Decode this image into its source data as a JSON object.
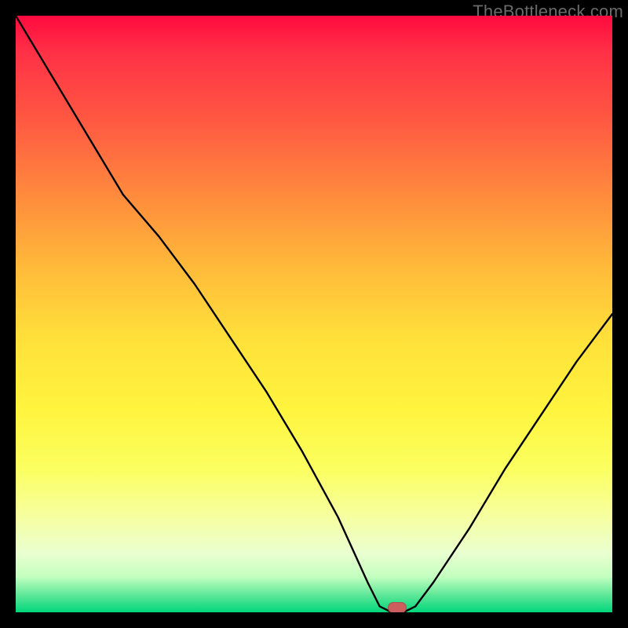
{
  "watermark": "TheBottleneck.com",
  "marker": {
    "x_pct": 64,
    "y_pct": 99.2,
    "color": "#cc5e5e"
  },
  "chart_data": {
    "type": "line",
    "title": "",
    "xlabel": "",
    "ylabel": "",
    "xlim": [
      0,
      100
    ],
    "ylim": [
      0,
      100
    ],
    "grid": false,
    "legend": false,
    "note": "Unlabeled bottleneck curve; percentages along y inferred from vertical position (0 at bottom-green, 100 at top-red). x inferred left→right 0–100.",
    "series": [
      {
        "name": "bottleneck-curve",
        "x": [
          0,
          6,
          12,
          18,
          24,
          30,
          36,
          42,
          48,
          54,
          59,
          61,
          63,
          65,
          67,
          70,
          76,
          82,
          88,
          94,
          100
        ],
        "y": [
          100,
          90,
          80,
          70,
          63,
          55,
          46,
          37,
          27,
          16,
          5,
          1,
          0,
          0,
          1,
          5,
          14,
          24,
          33,
          42,
          50
        ]
      }
    ],
    "marker_point": {
      "x": 64,
      "y": 0.8
    },
    "background_gradient": {
      "orientation": "vertical",
      "stops": [
        {
          "pct": 0,
          "color": "#ff0a3f"
        },
        {
          "pct": 18,
          "color": "#ff5a42"
        },
        {
          "pct": 42,
          "color": "#ffb93a"
        },
        {
          "pct": 66,
          "color": "#fff43e"
        },
        {
          "pct": 84,
          "color": "#f6ffa0"
        },
        {
          "pct": 97,
          "color": "#62e89a"
        },
        {
          "pct": 100,
          "color": "#00d67a"
        }
      ]
    }
  }
}
